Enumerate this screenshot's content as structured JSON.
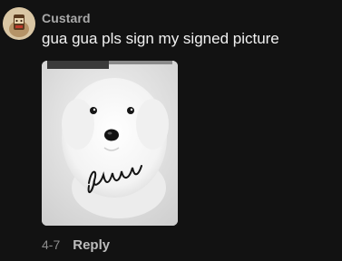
{
  "comment": {
    "username": "Custard",
    "text": "gua gua pls sign my signed picture",
    "date": "4-7",
    "reply_label": "Reply",
    "attachment": {
      "signature_text": "guagua"
    }
  },
  "colors": {
    "background": "#121212",
    "username": "#a9a9a9",
    "text": "#f2f2f2",
    "date": "#8d8d8d",
    "reply": "#bdbdbd"
  }
}
